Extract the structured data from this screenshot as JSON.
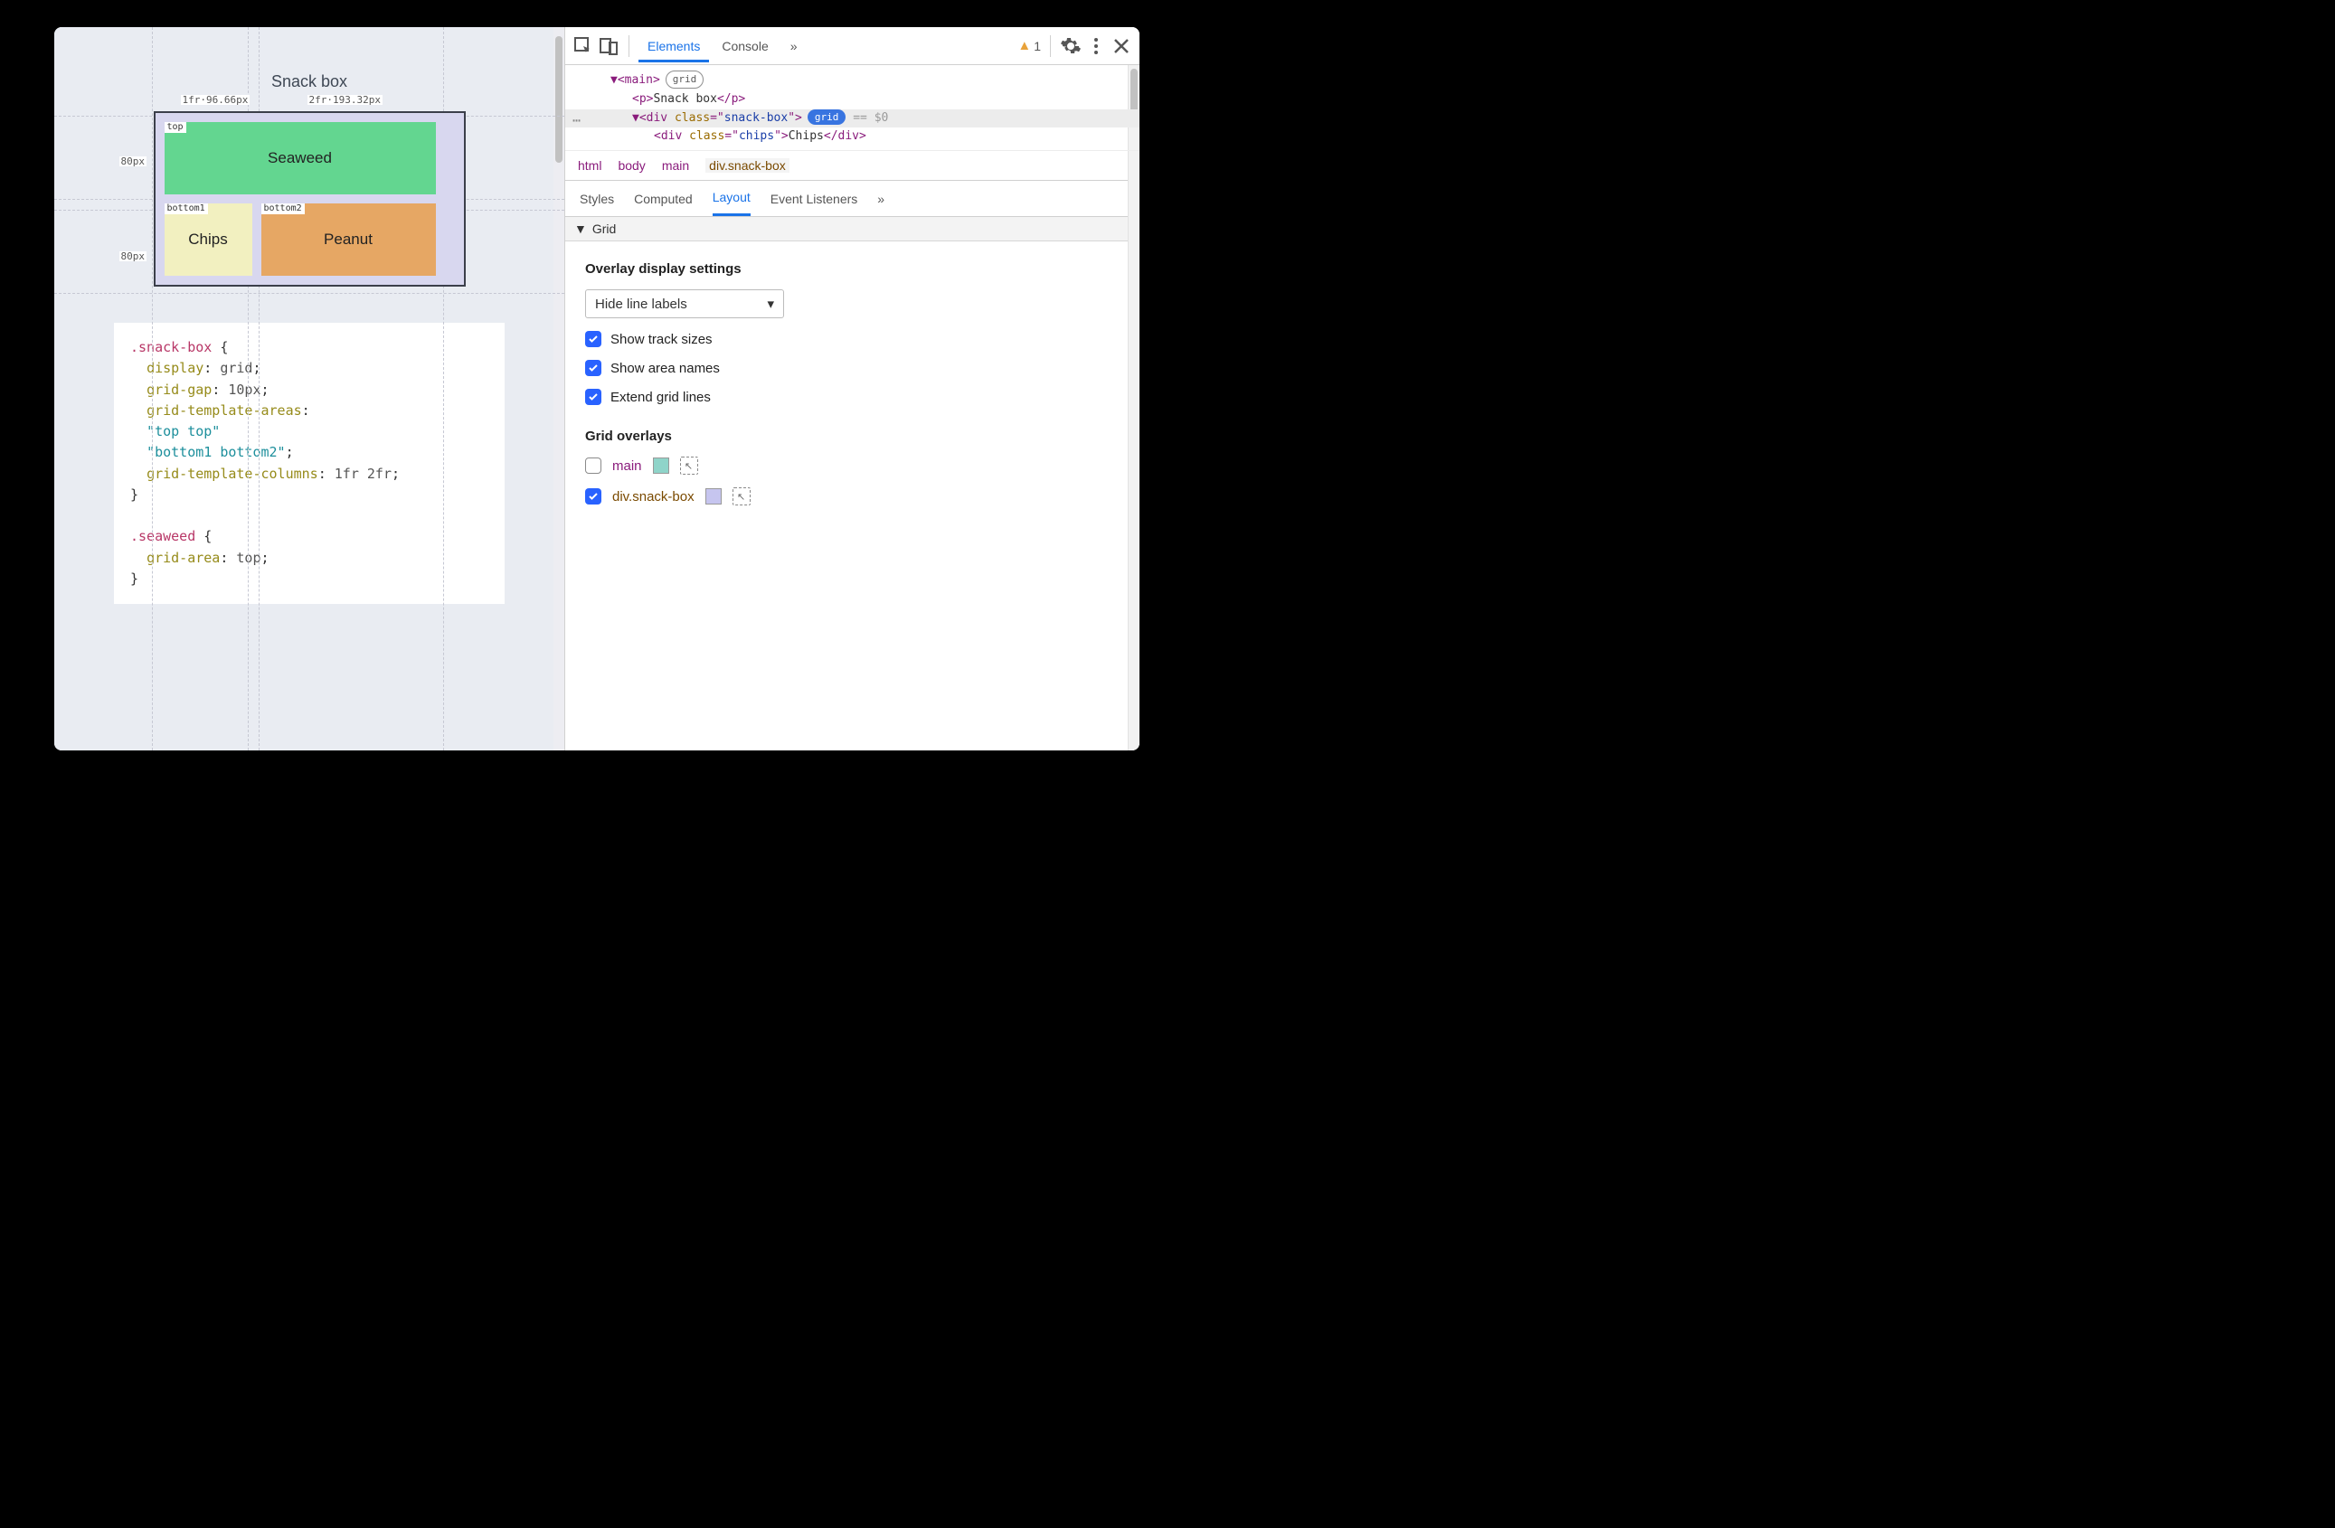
{
  "preview": {
    "title": "Snack box",
    "col1": "1fr·96.66px",
    "col2": "2fr·193.32px",
    "row1": "80px",
    "row2": "80px",
    "areaTop": "top",
    "areaB1": "bottom1",
    "areaB2": "bottom2",
    "seaweed": "Seaweed",
    "chips": "Chips",
    "peanut": "Peanut"
  },
  "code": {
    "sel1": ".snack-box",
    "brace": " {",
    "p1": "display",
    "v1": "grid",
    "p2": "grid-gap",
    "v2": "10px",
    "p3": "grid-template-areas",
    "s1": "\"top top\"",
    "s2": "\"bottom1 bottom2\"",
    "p4": "grid-template-columns",
    "v4": "1fr 2fr",
    "close": "}",
    "sel2": ".seaweed",
    "p5": "grid-area",
    "v5": "top"
  },
  "toolbar": {
    "elements": "Elements",
    "console": "Console",
    "more": "»",
    "warnCount": "1"
  },
  "dom": {
    "l1a": "▼<",
    "l1b": "main",
    "l1c": ">",
    "l1badge": "grid",
    "l2a": "<",
    "l2b": "p",
    "l2c": ">",
    "l2t": "Snack box",
    "l2d": "</",
    "l2e": "p",
    "l2f": ">",
    "l3a": "▼<",
    "l3b": "div",
    "l3c": " class",
    "l3d": "=\"",
    "l3e": "snack-box",
    "l3f": "\">",
    "l3badge": "grid",
    "l3eq": " == ",
    "l3ref": "$0",
    "l4a": "<",
    "l4b": "div",
    "l4c": " class",
    "l4d": "=\"",
    "l4e": "chips",
    "l4f": "\">",
    "l4t": "Chips",
    "l4g": "</",
    "l4h": "div",
    "l4i": ">"
  },
  "crumbs": {
    "html": "html",
    "body": "body",
    "main": "main",
    "cur": "div.snack-box"
  },
  "subtabs": {
    "styles": "Styles",
    "computed": "Computed",
    "layout": "Layout",
    "listeners": "Event Listeners",
    "more": "»"
  },
  "grid": {
    "section": "Grid",
    "overlayTitle": "Overlay display settings",
    "select": "Hide line labels",
    "opt1": "Show track sizes",
    "opt2": "Show area names",
    "opt3": "Extend grid lines",
    "overlaysTitle": "Grid overlays",
    "ov1": "main",
    "ov2": "div.snack-box"
  }
}
